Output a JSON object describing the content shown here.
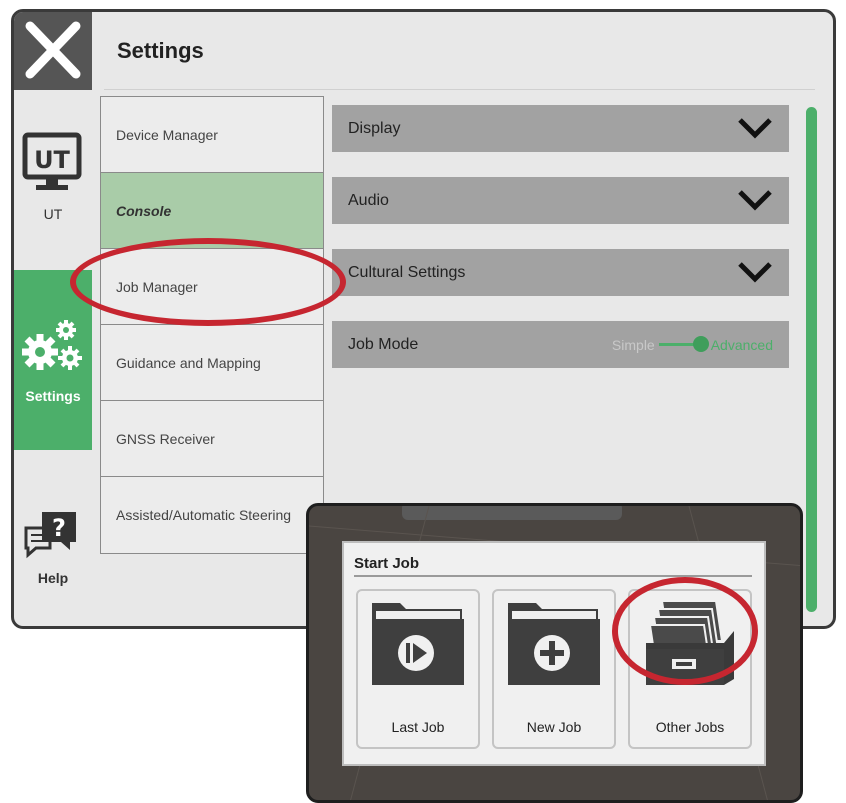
{
  "header": {
    "title": "Settings",
    "close_icon": "close-icon"
  },
  "rail": [
    {
      "label": "UT",
      "icon": "ut-monitor-icon"
    },
    {
      "label": "Settings",
      "icon": "gears-icon",
      "active": true
    },
    {
      "label": "Help",
      "icon": "help-chat-icon"
    }
  ],
  "menu": [
    {
      "label": "Device Manager"
    },
    {
      "label": "Console",
      "active": true
    },
    {
      "label": "Job Manager"
    },
    {
      "label": "Guidance and Mapping"
    },
    {
      "label": "GNSS Receiver"
    },
    {
      "label": "Assisted/Automatic Steering"
    }
  ],
  "panel": {
    "display": "Display",
    "audio": "Audio",
    "cultural": "Cultural Settings",
    "job_mode": {
      "label": "Job Mode",
      "off_label": "Simple",
      "on_label": "Advanced",
      "value": "Advanced"
    }
  },
  "colors": {
    "accent": "#4caf6a",
    "annotation": "#c62630",
    "active_menu": "#a9cca8"
  },
  "start_job": {
    "title": "Start Job",
    "buttons": [
      {
        "label": "Last Job",
        "icon": "folder-play-icon"
      },
      {
        "label": "New Job",
        "icon": "folder-plus-icon"
      },
      {
        "label": "Other Jobs",
        "icon": "file-cabinet-icon"
      }
    ]
  }
}
